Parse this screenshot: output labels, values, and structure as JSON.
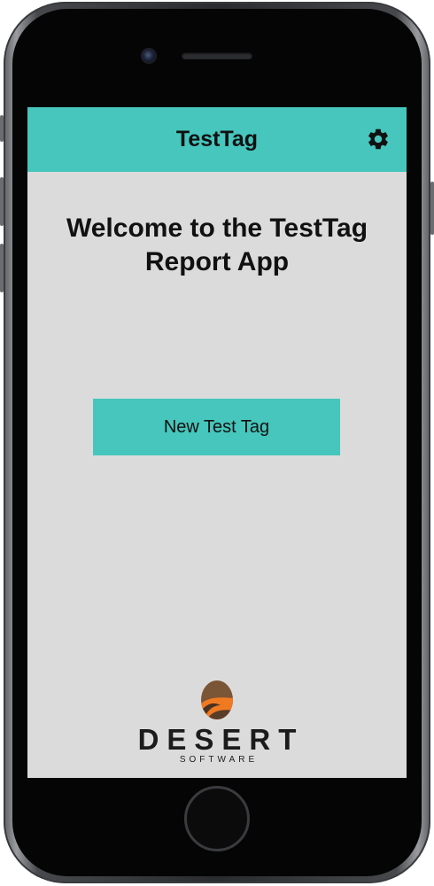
{
  "app": {
    "title": "TestTag"
  },
  "icons": {
    "settings": "gear-icon",
    "logo": "desert-logo-icon"
  },
  "colors": {
    "accent": "#46c6bc",
    "screen_background": "#dbdbdb",
    "text": "#111111",
    "logo_orange": "#f07a22",
    "logo_brown": "#7a5536"
  },
  "main": {
    "welcome_line1": "Welcome to the TestTag",
    "welcome_line2": "Report App",
    "new_tag_button": "New Test Tag"
  },
  "footer": {
    "logo_name": "DESERT",
    "logo_subtitle": "SOFTWARE"
  }
}
